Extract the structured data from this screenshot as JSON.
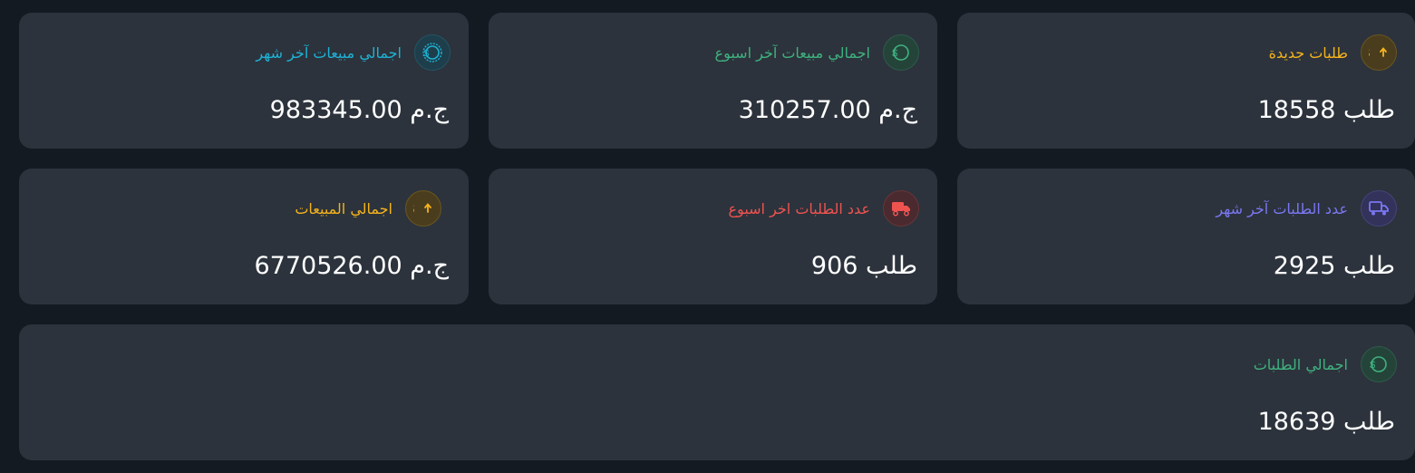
{
  "cards": [
    {
      "id": "new-orders",
      "label": "طلبات جديدة",
      "value_text": "18558 طلب",
      "icon": "dollar-up-icon",
      "color": "#f6b31b"
    },
    {
      "id": "week-sales",
      "label": "اجمالي مبيعات آخر اسبوع",
      "value_text": "310257.00 ج.م",
      "icon": "coin-icon",
      "color": "#3fb27f"
    },
    {
      "id": "month-sales",
      "label": "اجمالي مبيعات آخر شهر",
      "value_text": "983345.00 ج.م",
      "icon": "coin-badge-icon",
      "color": "#1fb2d5"
    },
    {
      "id": "month-orders",
      "label": "عدد الطلبات آخر شهر",
      "value_text": "2925 طلب",
      "icon": "truck-icon",
      "color": "#7a77f2"
    },
    {
      "id": "week-orders",
      "label": "عدد الطلبات اخر اسبوع",
      "value_text": "906 طلب",
      "icon": "truck-icon",
      "color": "#ef5350"
    },
    {
      "id": "total-sales",
      "label": "اجمالي المبيعات",
      "value_text": "6770526.00 ج.م",
      "icon": "dollar-up-icon",
      "color": "#f6b31b"
    },
    {
      "id": "total-orders",
      "label": "اجمالي الطلبات",
      "value_text": "18639 طلب",
      "icon": "coin-icon",
      "color": "#3fb27f"
    }
  ]
}
